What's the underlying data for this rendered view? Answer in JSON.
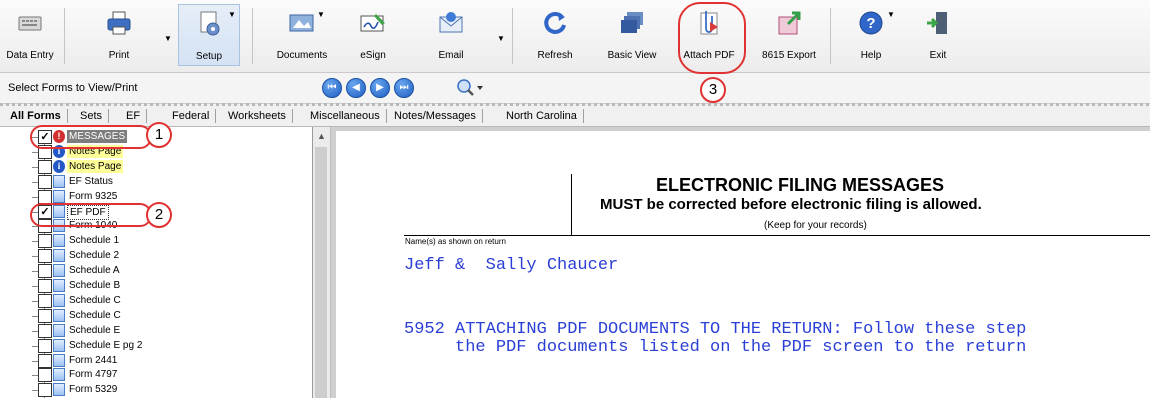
{
  "toolbar": {
    "data_entry": "Data Entry",
    "print": "Print",
    "setup": "Setup",
    "documents": "Documents",
    "esign": "eSign",
    "email": "Email",
    "refresh": "Refresh",
    "basic_view": "Basic View",
    "attach_pdf": "Attach PDF",
    "export_8615": "8615 Export",
    "help": "Help",
    "exit": "Exit"
  },
  "secondary": {
    "label": "Select Forms to View/Print"
  },
  "tabs": [
    "All Forms",
    "Sets",
    "EF",
    "Federal",
    "Worksheets",
    "Miscellaneous",
    "Notes/Messages",
    "North Carolina"
  ],
  "tree": {
    "items": [
      {
        "label": "MESSAGES",
        "checked": true,
        "icon": "error-icon"
      },
      {
        "label": "Notes Page",
        "checked": false,
        "icon": "info-icon"
      },
      {
        "label": "Notes Page",
        "checked": false,
        "icon": "info-icon"
      },
      {
        "label": "EF Status",
        "checked": false,
        "icon": "document-icon"
      },
      {
        "label": "Form 9325",
        "checked": false,
        "icon": "document-icon"
      },
      {
        "label": "EF PDF",
        "checked": true,
        "icon": "document-icon"
      },
      {
        "label": "Form 1040",
        "checked": false,
        "icon": "document-icon"
      },
      {
        "label": "Schedule 1",
        "checked": false,
        "icon": "document-icon"
      },
      {
        "label": "Schedule 2",
        "checked": false,
        "icon": "document-icon"
      },
      {
        "label": "Schedule A",
        "checked": false,
        "icon": "document-icon"
      },
      {
        "label": "Schedule B",
        "checked": false,
        "icon": "document-icon"
      },
      {
        "label": "Schedule C",
        "checked": false,
        "icon": "document-icon"
      },
      {
        "label": "Schedule C",
        "checked": false,
        "icon": "document-icon"
      },
      {
        "label": "Schedule E",
        "checked": false,
        "icon": "document-icon"
      },
      {
        "label": "Schedule E pg 2",
        "checked": false,
        "icon": "document-icon"
      },
      {
        "label": "Form 2441",
        "checked": false,
        "icon": "document-icon"
      },
      {
        "label": "Form 4797",
        "checked": false,
        "icon": "document-icon"
      },
      {
        "label": "Form 5329",
        "checked": false,
        "icon": "document-icon"
      }
    ]
  },
  "document": {
    "title": "ELECTRONIC FILING MESSAGES",
    "subtitle": "MUST be corrected before electronic filing is allowed.",
    "note": "(Keep for your records)",
    "names_label": "Name(s) as shown on return",
    "taxpayer": "Jeff &  Sally Chaucer",
    "message_line1": "5952 ATTACHING PDF DOCUMENTS TO THE RETURN: Follow these step",
    "message_line2": "     the PDF documents listed on the PDF screen to the return"
  },
  "callouts": [
    "1",
    "2",
    "3"
  ],
  "colors": {
    "callout": "#e03232",
    "doc_text": "#2a3fd6",
    "highlight": "#ffff99"
  }
}
